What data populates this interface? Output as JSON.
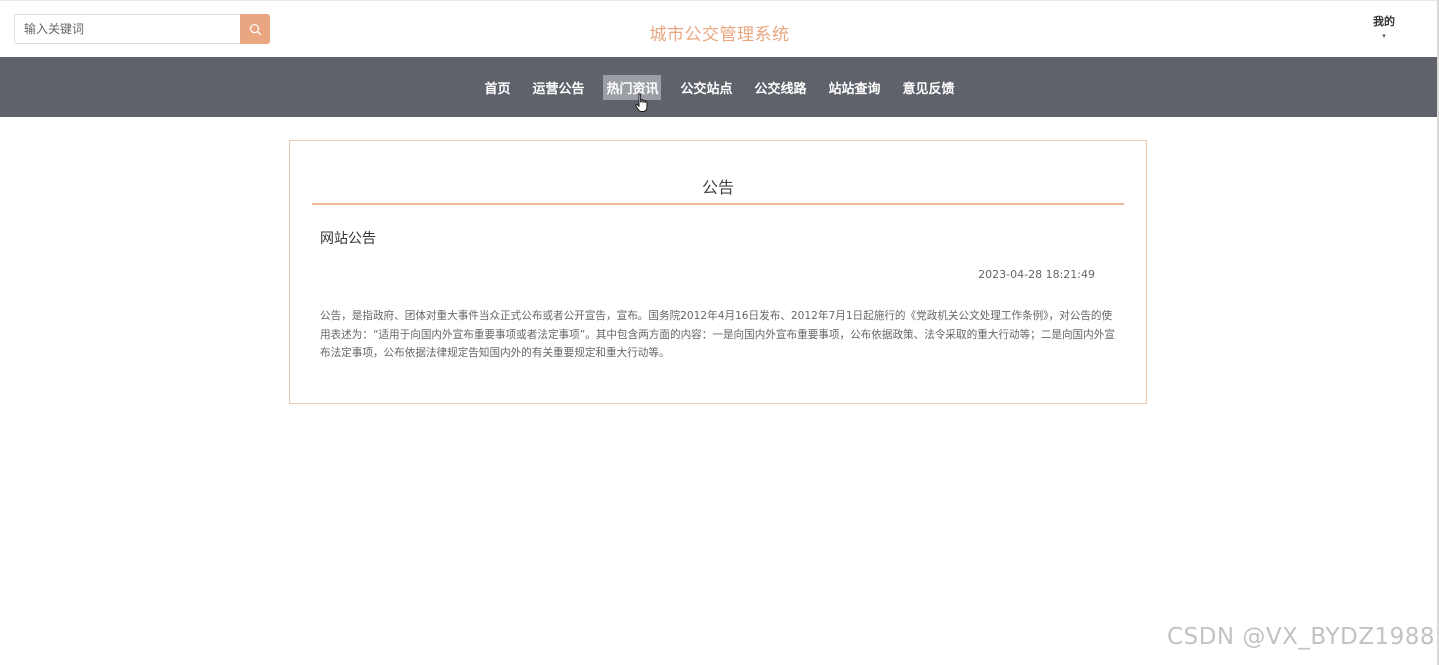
{
  "header": {
    "search_placeholder": "输入关键词",
    "site_title": "城市公交管理系统",
    "user_menu_label": "我的",
    "user_menu_caret": "▾"
  },
  "nav": {
    "items": [
      "首页",
      "运营公告",
      "热门资讯",
      "公交站点",
      "公交线路",
      "站站查询",
      "意见反馈"
    ],
    "active_index": 2
  },
  "card": {
    "title": "公告",
    "notice_title": "网站公告",
    "notice_time": "2023-04-28 18:21:49",
    "notice_body": "公告，是指政府、团体对重大事件当众正式公布或者公开宣告，宣布。国务院2012年4月16日发布、2012年7月1日起施行的《党政机关公文处理工作条例》，对公告的使用表述为：“适用于向国内外宣布重要事项或者法定事项”。其中包含两方面的内容：一是向国内外宣布重要事项，公布依据政策、法令采取的重大行动等；二是向国内外宣布法定事项，公布依据法律规定告知国内外的有关重要规定和重大行动等。"
  },
  "watermark": "CSDN @VX_BYDZ1988",
  "colors": {
    "accent": "#e9a680",
    "navbar_bg": "#5f626b",
    "active_nav_bg": "#9b9ea5",
    "card_border": "#efc8b0"
  },
  "icons": {
    "search_button": "search-icon",
    "cursor": "hand-pointer-icon"
  }
}
